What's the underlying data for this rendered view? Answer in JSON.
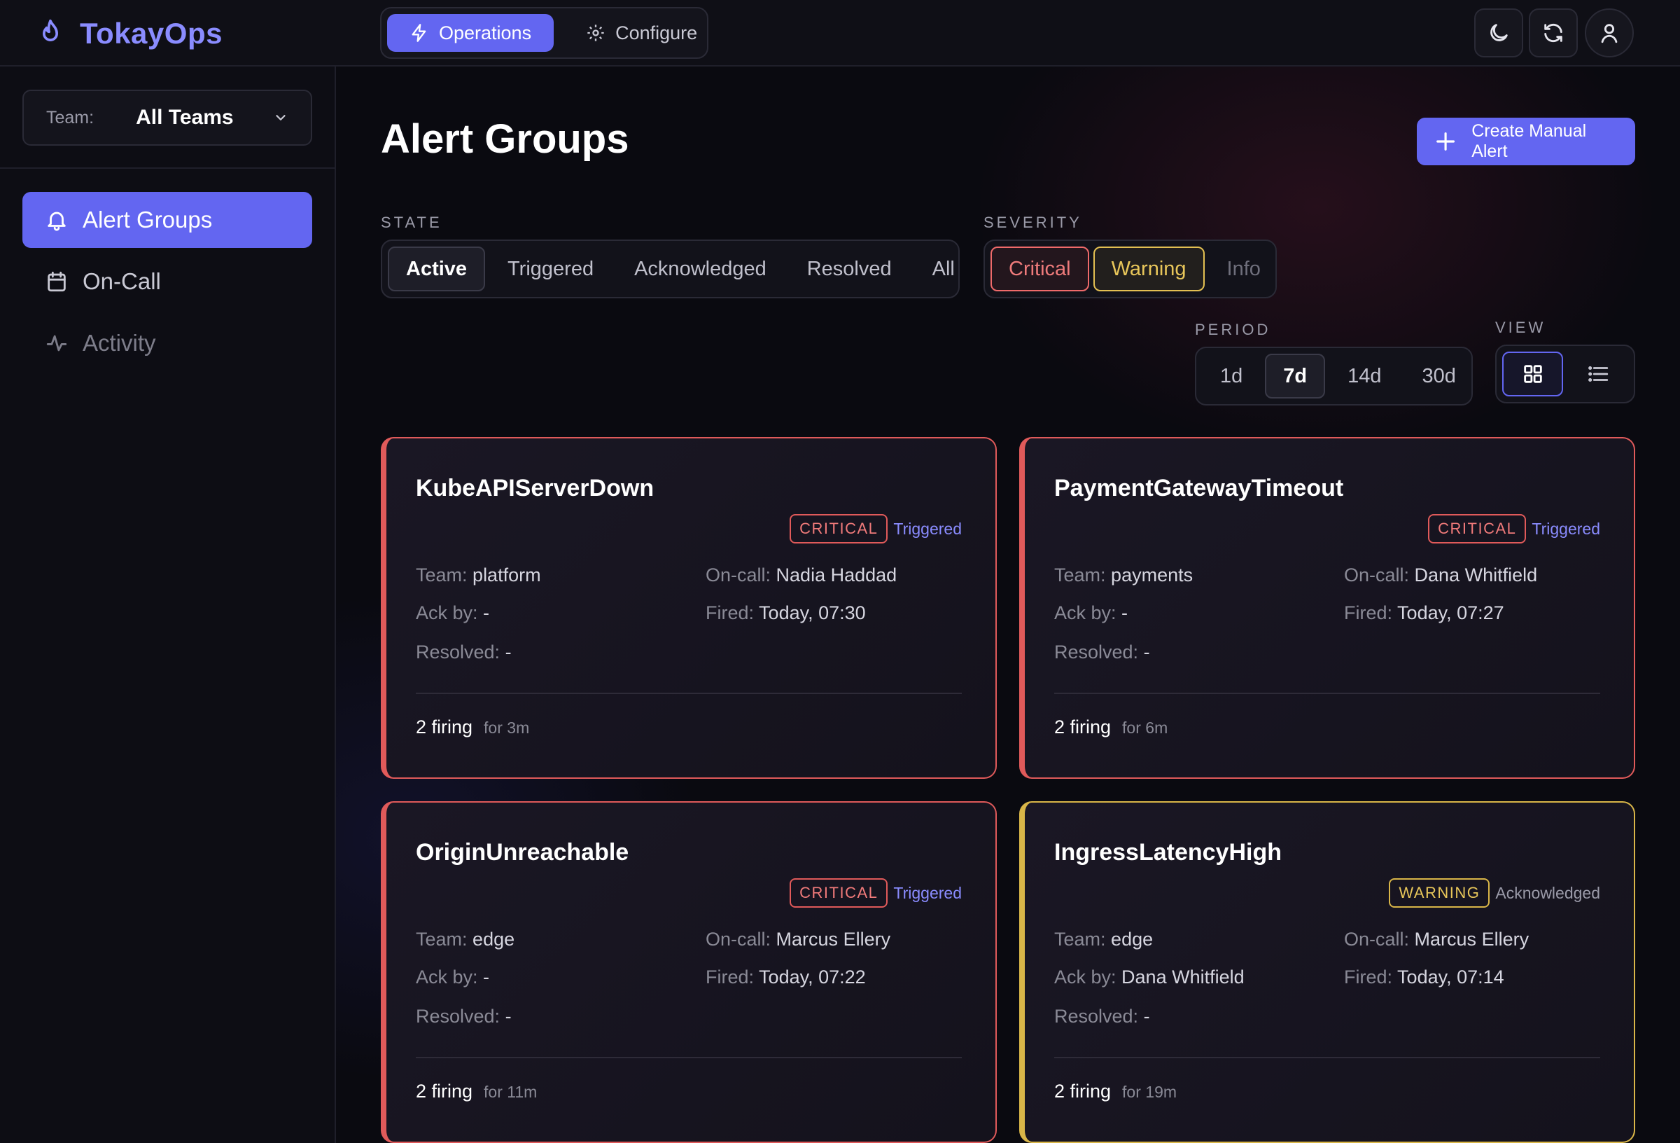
{
  "app": {
    "name": "TokayOps"
  },
  "modes": [
    {
      "label": "Operations",
      "icon": "bolt-icon",
      "active": true
    },
    {
      "label": "Configure",
      "icon": "gear-icon",
      "active": false
    }
  ],
  "topbar_icons": [
    "moon-icon",
    "refresh-icon",
    "user-icon"
  ],
  "sidebar": {
    "team_label": "Team:",
    "team_value": "All Teams",
    "items": [
      {
        "label": "Alert Groups",
        "icon": "bell-icon",
        "active": true
      },
      {
        "label": "On-Call",
        "icon": "calendar-icon",
        "active": false
      },
      {
        "label": "Activity",
        "icon": "activity-icon",
        "active": false
      }
    ]
  },
  "main": {
    "title": "Alert Groups",
    "create_button": "Create Manual Alert",
    "state": {
      "label": "STATE",
      "options": [
        "Active",
        "Triggered",
        "Acknowledged",
        "Resolved",
        "All"
      ],
      "selected": "Active"
    },
    "severity": {
      "label": "SEVERITY",
      "options": [
        "Critical",
        "Warning",
        "Info"
      ],
      "selected": [
        "Critical",
        "Warning"
      ]
    },
    "period": {
      "label": "PERIOD",
      "options": [
        "1d",
        "7d",
        "14d",
        "30d"
      ],
      "selected": "7d"
    },
    "view": {
      "label": "VIEW",
      "options": [
        "grid-icon",
        "list-icon"
      ],
      "selected": "grid-icon"
    }
  },
  "cards": [
    {
      "name": "KubeAPIServerDown",
      "severity": "CRITICAL",
      "state": "Triggered",
      "team_label": "Team:",
      "team": "platform",
      "oncall_label": "On-call:",
      "oncall": "Nadia Haddad",
      "ack_label": "Ack by:",
      "ack": "-",
      "fired_label": "Fired:",
      "fired": "Today, 07:30",
      "resolved_label": "Resolved:",
      "resolved": "-",
      "firing": "2 firing",
      "duration": "for 3m"
    },
    {
      "name": "PaymentGatewayTimeout",
      "severity": "CRITICAL",
      "state": "Triggered",
      "team_label": "Team:",
      "team": "payments",
      "oncall_label": "On-call:",
      "oncall": "Dana Whitfield",
      "ack_label": "Ack by:",
      "ack": "-",
      "fired_label": "Fired:",
      "fired": "Today, 07:27",
      "resolved_label": "Resolved:",
      "resolved": "-",
      "firing": "2 firing",
      "duration": "for 6m"
    },
    {
      "name": "OriginUnreachable",
      "severity": "CRITICAL",
      "state": "Triggered",
      "team_label": "Team:",
      "team": "edge",
      "oncall_label": "On-call:",
      "oncall": "Marcus Ellery",
      "ack_label": "Ack by:",
      "ack": "-",
      "fired_label": "Fired:",
      "fired": "Today, 07:22",
      "resolved_label": "Resolved:",
      "resolved": "-",
      "firing": "2 firing",
      "duration": "for 11m"
    },
    {
      "name": "IngressLatencyHigh",
      "severity": "WARNING",
      "state": "Acknowledged",
      "team_label": "Team:",
      "team": "edge",
      "oncall_label": "On-call:",
      "oncall": "Marcus Ellery",
      "ack_label": "Ack by:",
      "ack": "Dana Whitfield",
      "fired_label": "Fired:",
      "fired": "Today, 07:14",
      "resolved_label": "Resolved:",
      "resolved": "-",
      "firing": "2 firing",
      "duration": "for 19m"
    }
  ],
  "colors": {
    "accent": "#6366f1",
    "critical": "#e05a5a",
    "warning": "#d9b648",
    "triggered": "#8a8cff"
  }
}
